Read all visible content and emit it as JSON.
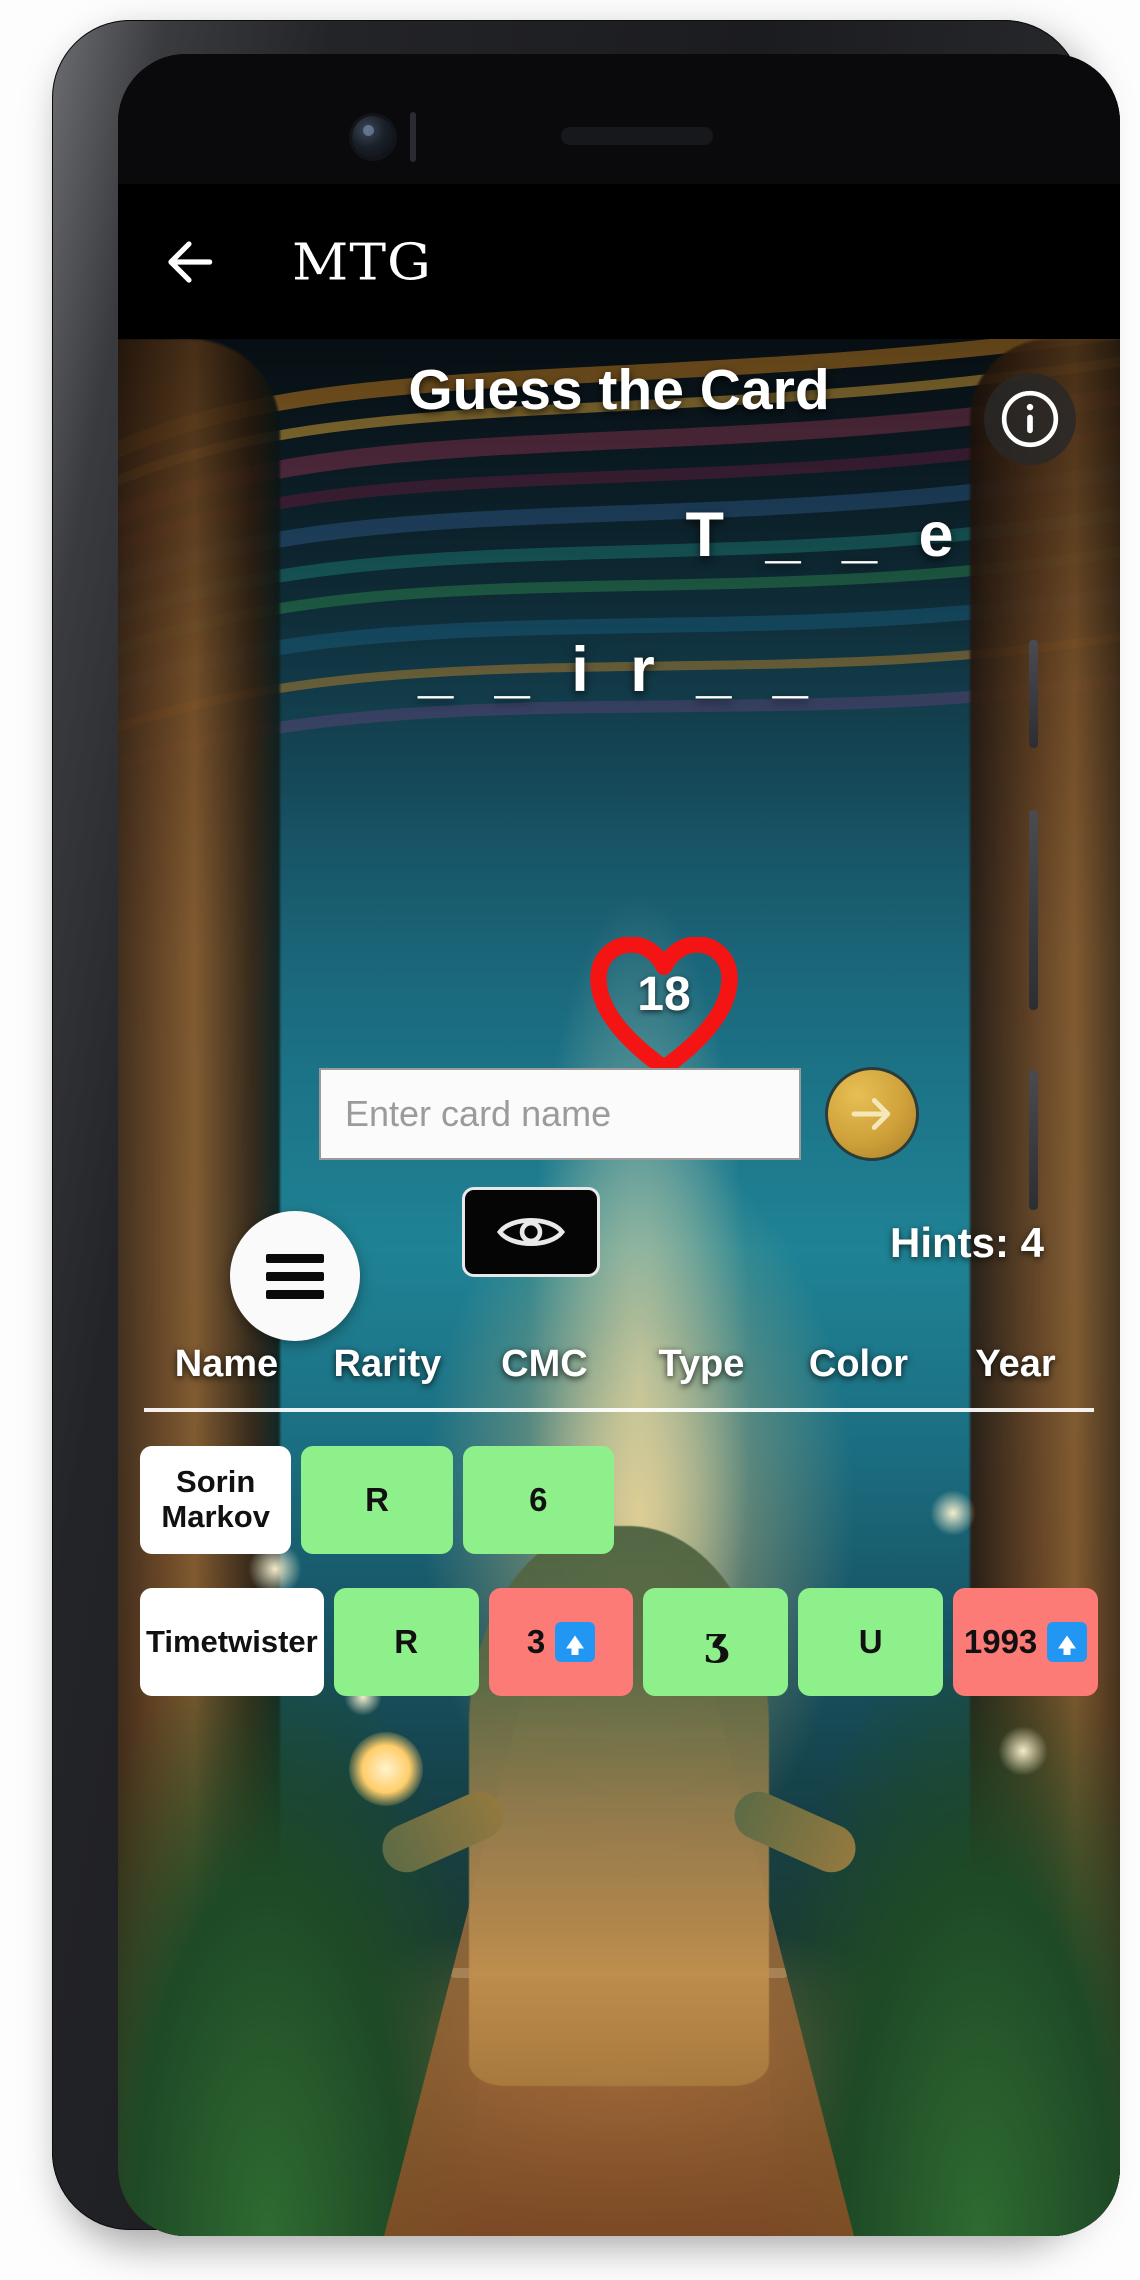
{
  "app": {
    "logo_text": "MTG",
    "back_icon": "back-arrow-icon"
  },
  "game": {
    "title": "Guess the Card",
    "info_icon": "info-icon",
    "puzzle_line1": "T _ _ e",
    "puzzle_line2": "_ _ i r _ _",
    "lives": "18",
    "heart_icon": "heart-icon",
    "input_placeholder": "Enter card name",
    "input_value": "",
    "submit_icon": "arrow-right-icon",
    "hint_icon": "eye-icon",
    "hints_label": "Hints: 4",
    "menu_icon": "hamburger-menu-icon"
  },
  "table": {
    "headers": [
      "Name",
      "Rarity",
      "CMC",
      "Type",
      "Color",
      "Year"
    ],
    "rows": [
      {
        "cells": [
          {
            "text": "Sorin Markov",
            "state": "name"
          },
          {
            "text": "R",
            "state": "green"
          },
          {
            "text": "6",
            "state": "green"
          },
          {
            "text": "",
            "state": "blank"
          },
          {
            "text": "",
            "state": "blank"
          },
          {
            "text": "",
            "state": "blank"
          }
        ]
      },
      {
        "cells": [
          {
            "text": "Timetwister",
            "state": "name"
          },
          {
            "text": "R",
            "state": "green"
          },
          {
            "text": "3",
            "state": "red",
            "hint": "up"
          },
          {
            "text": "ʒ",
            "state": "green",
            "glyph": true
          },
          {
            "text": "U",
            "state": "green"
          },
          {
            "text": "1993",
            "state": "red",
            "hint": "up"
          }
        ]
      }
    ]
  },
  "colors": {
    "correct": "#8ef08a",
    "wrong": "#fc7b77",
    "accent_gold": "#cfa13a",
    "heart_red": "#f51414",
    "hint_blue": "#2196f3"
  }
}
